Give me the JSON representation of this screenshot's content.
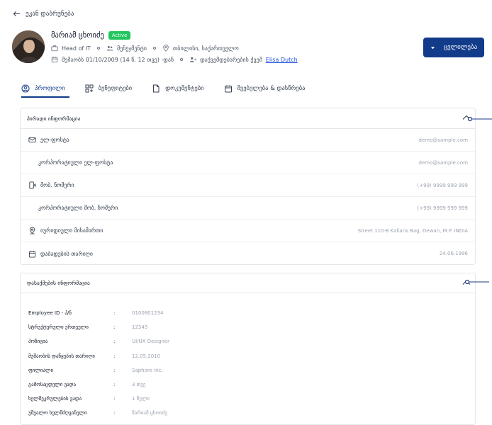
{
  "back": {
    "label": "უკან დაბრუნება"
  },
  "profile": {
    "name": "მარიამ ცხოიძე",
    "status": "Active",
    "role": "Head of IT",
    "department": "მენეჯმენტი",
    "location": "თბილისი, საქართველო",
    "hired": "მუშაობს 01/10/2009 (14 წ. 12 თვე) -დან",
    "added_by_prefix": "დაქვემდებარების ქვეშ",
    "added_by_name": "Elisa Dutch"
  },
  "actions": {
    "edit_label": "ცვლილება"
  },
  "tabs": [
    {
      "label": "პროფილი"
    },
    {
      "label": "ბენეფიტები"
    },
    {
      "label": "დოკუმენტები"
    },
    {
      "label": "შვებულება & დასწრება"
    }
  ],
  "personal": {
    "title": "პირადი ინფორმაცია",
    "rows": [
      {
        "label": "ელ-ფოსტა",
        "value": "demo@sample.com"
      },
      {
        "label": "კორპორატიული ელ-ფოსტა",
        "value": "demo@sample.com"
      },
      {
        "label": "მობ. ნომერი",
        "value": "(+99) 9999 999 999"
      },
      {
        "label": "კორპორატიული მობ. ნომერი",
        "value": "(+99) 9999 999 999"
      },
      {
        "label": "იურიდიული მისამართი",
        "value": "Street 110-B Kalians Bag, Dewan, M.P. INDIA"
      },
      {
        "label": "დაბადების თარიღი",
        "value": "24.06.1996"
      }
    ]
  },
  "employment": {
    "title": "დასაქმების ინფორმაცია",
    "rows": [
      {
        "label": "Employee ID - პ/ნ",
        "value": "0100801234"
      },
      {
        "label": "სტრუქტურული ერთეული",
        "value": "12345"
      },
      {
        "label": "პოზიცია",
        "value": "UI/UX Designer"
      },
      {
        "label": "მუშაობის დაწყების თარიღი",
        "value": "12.05.2010"
      },
      {
        "label": "ფილიალი",
        "value": "Saphore Inc."
      },
      {
        "label": "გამოსაცდელი ვადა",
        "value": "3 თვე"
      },
      {
        "label": "ხელშეკრულების ვადა",
        "value": "1 წელი"
      },
      {
        "label": "უშუალო ხელმძღვანელი",
        "value": "მარიამ ცხოიძე"
      }
    ],
    "colon": ":"
  }
}
